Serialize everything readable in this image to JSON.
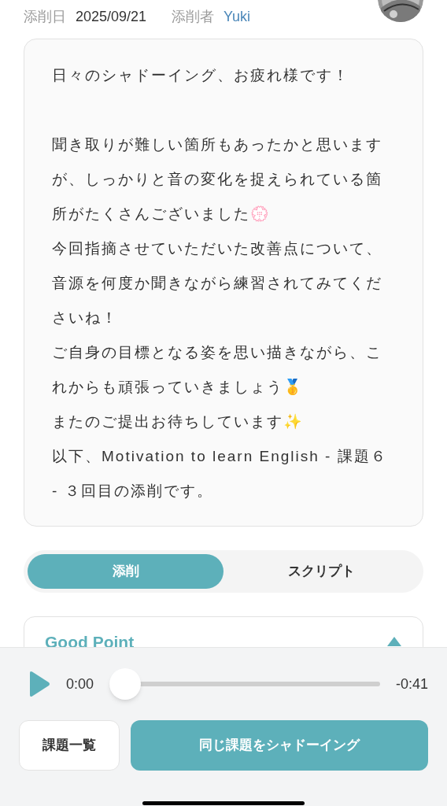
{
  "header": {
    "date_label": "添削日",
    "date": "2025/09/21",
    "reviewer_label": "添削者",
    "reviewer": "Yuki"
  },
  "message": {
    "greeting": "日々のシャドーイング、お疲れ様です！",
    "paragraphs": [
      "聞き取りが難しい箇所もあったかと思いますが、しっかりと音の変化を捉えられている箇所がたくさんございました💮",
      "今回指摘させていただいた改善点について、音源を何度か聞きながら練習されてみてくださいね！",
      "ご自身の目標となる姿を思い描きながら、これからも頑張っていきましょう🥇",
      "またのご提出お待ちしています✨",
      "以下、Motivation to learn English - 課題６ - ３回目の添削です。"
    ]
  },
  "tabs": [
    {
      "label": "添削",
      "selected": true
    },
    {
      "label": "スクリプト",
      "selected": false
    }
  ],
  "section": {
    "title": "Good Point",
    "expanded": true
  },
  "player": {
    "elapsed": "0:00",
    "remaining": "-0:41",
    "level": 0
  },
  "buttons": [
    {
      "label": "課題一覧",
      "kind": "secondary"
    },
    {
      "label": "同じ課題をシャドーイング",
      "kind": "primary"
    }
  ]
}
